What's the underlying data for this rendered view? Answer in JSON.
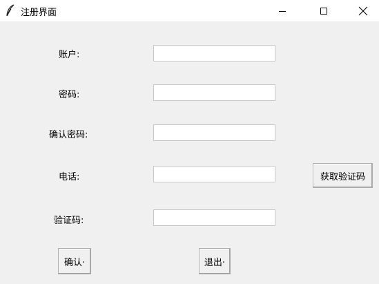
{
  "window": {
    "title": "注册界面",
    "icon": "feather-icon",
    "controls": [
      "minimize-icon",
      "maximize-icon",
      "close-icon"
    ]
  },
  "form": {
    "account_label": "账户:",
    "password_label": "密码:",
    "confirm_password_label": "确认密码:",
    "phone_label": "电话:",
    "code_label": "验证码:",
    "account_value": "",
    "password_value": "",
    "confirm_password_value": "",
    "phone_value": "",
    "code_value": "",
    "get_code_button": "获取验证码",
    "confirm_button": "确认·",
    "exit_button": "退出·"
  }
}
